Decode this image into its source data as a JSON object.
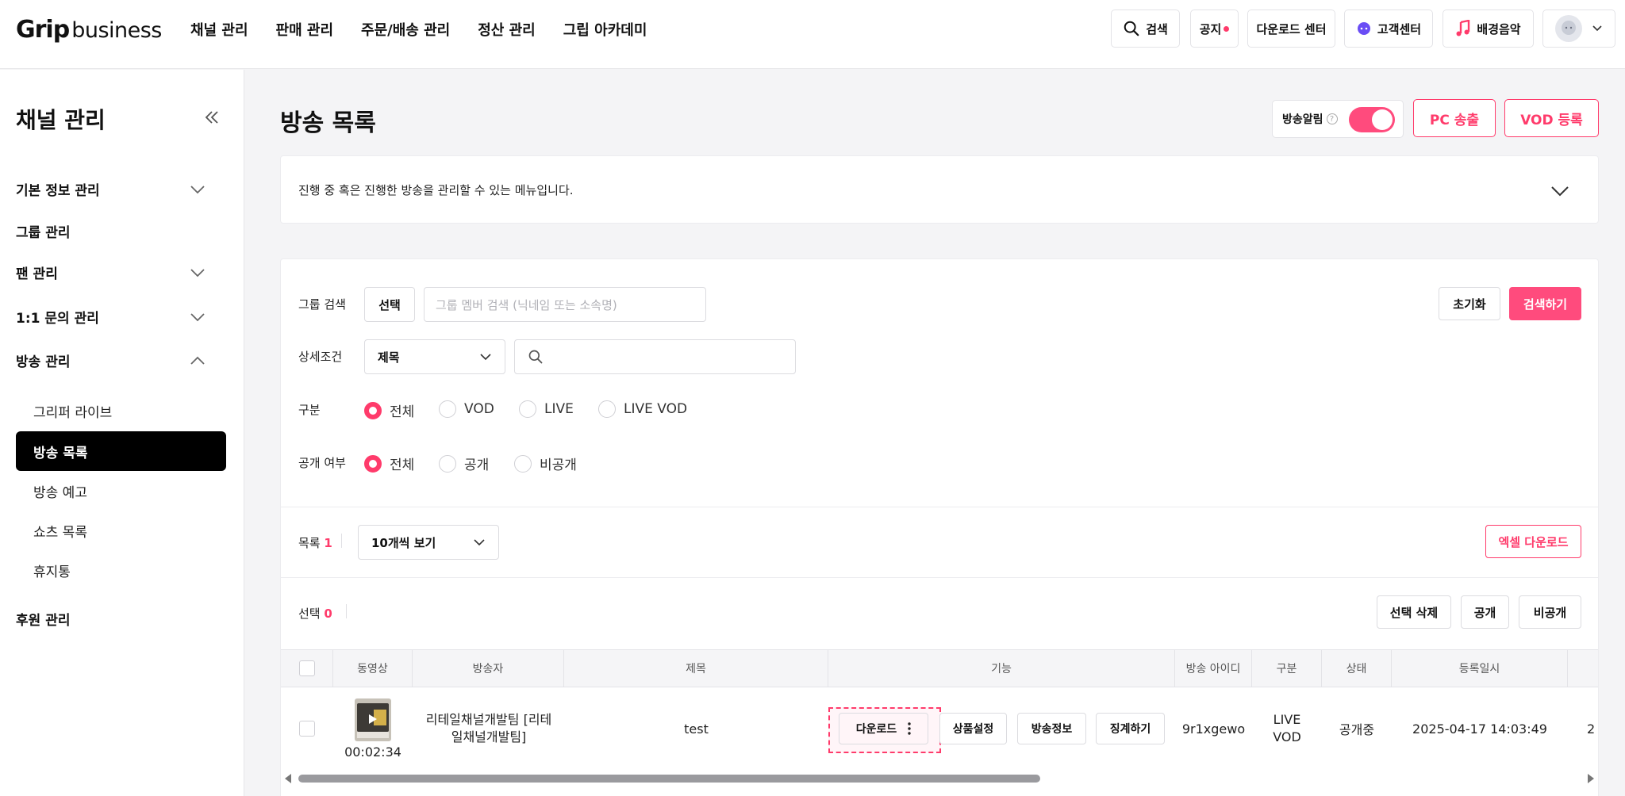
{
  "header": {
    "logo_grip": "Grip",
    "logo_business": "business",
    "nav": [
      "채널 관리",
      "판매 관리",
      "주문/배송 관리",
      "정산 관리",
      "그립 아카데미"
    ],
    "search_label": "검색",
    "notice_label": "공지",
    "download_center_label": "다운로드 센터",
    "support_label": "고객센터",
    "bgm_label": "배경음악"
  },
  "sidebar": {
    "title": "채널 관리",
    "items": [
      {
        "label": "기본 정보 관리"
      },
      {
        "label": "그룹 관리"
      },
      {
        "label": "팬 관리"
      },
      {
        "label": "1:1 문의 관리"
      },
      {
        "label": "방송 관리"
      },
      {
        "label": "후원 관리"
      }
    ],
    "sub_items": [
      "그리퍼 라이브",
      "방송 목록",
      "방송 예고",
      "쇼츠 목록",
      "휴지통"
    ]
  },
  "main": {
    "title": "방송 목록",
    "alarm_label": "방송알림",
    "alarm_help": "?",
    "alarm_on": true,
    "pc_button": "PC 송출",
    "vod_button": "VOD 등록",
    "info_text": "진행 중 혹은 진행한 방송을 관리할 수 있는 메뉴입니다."
  },
  "filters": {
    "group_label": "그룹 검색",
    "group_select": "선택",
    "group_placeholder": "그룹 멤버 검색 (닉네임 또는 소속명)",
    "reset": "초기화",
    "search": "검색하기",
    "detail_label": "상세조건",
    "detail_value": "제목",
    "type_label": "구분",
    "type_options": [
      "전체",
      "VOD",
      "LIVE",
      "LIVE VOD"
    ],
    "public_label": "공개 여부",
    "public_options": [
      "전체",
      "공개",
      "비공개"
    ]
  },
  "list": {
    "count_label": "목록",
    "count": "1",
    "page_size": "10개씩 보기",
    "excel": "엑셀 다운로드",
    "selected_label": "선택",
    "selected_count": "0",
    "delete_selected": "선택 삭제",
    "make_public": "공개",
    "make_private": "비공개"
  },
  "table": {
    "columns": [
      "동영상",
      "방송자",
      "제목",
      "기능",
      "방송 아이디",
      "구분",
      "상태",
      "등록일시"
    ],
    "row": {
      "duration": "00:02:34",
      "broadcaster": "리테일채널개발팀 [리테일채널개발팀]",
      "title": "test",
      "actions": [
        "다운로드",
        "상품설정",
        "방송정보",
        "징계하기"
      ],
      "broadcast_id": "9r1xgewo",
      "type_line1": "LIVE",
      "type_line2": "VOD",
      "status": "공개중",
      "registered": "2025-04-17 14:03:49",
      "next_col_peek": "2"
    }
  },
  "colors": {
    "accent": "#ff3b6b",
    "toggle": "#ff4b7d"
  }
}
